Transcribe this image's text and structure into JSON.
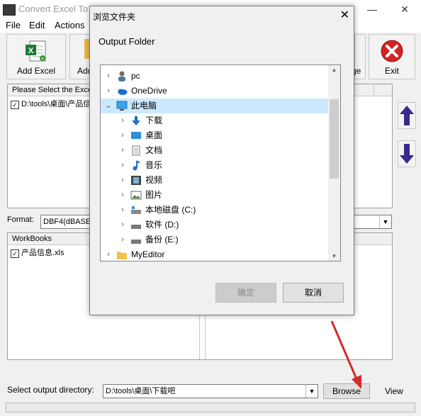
{
  "app": {
    "title": "Convert Excel To DBF"
  },
  "window_controls": {
    "minimize": "—",
    "maximize": "☐",
    "close": "✕"
  },
  "menu": {
    "items": [
      "File",
      "Edit",
      "Actions"
    ]
  },
  "toolbar": {
    "add_excel": "Add Excel",
    "add_partial": "Add",
    "change_partial": "ge",
    "exit": "Exit"
  },
  "file_list": {
    "header": "Please Select the Excel",
    "rows": [
      "D:\\tools\\桌面\\产品信"
    ]
  },
  "format": {
    "label": "Format:",
    "value": "DBF4(dBASE"
  },
  "workbooks": {
    "header": "WorkBooks",
    "rows": [
      "产品信息.xls"
    ]
  },
  "output": {
    "label": "Select  output directory:",
    "value": "D:\\tools\\桌面\\下载吧",
    "browse": "Browse",
    "view": "View"
  },
  "dialog": {
    "title": "浏览文件夹",
    "close": "✕",
    "subtitle": "Output Folder",
    "ok": "确定",
    "cancel": "取消",
    "tree": [
      {
        "label": "pc",
        "icon": "user-icon",
        "chevron": "›"
      },
      {
        "label": "OneDrive",
        "icon": "cloud-icon",
        "chevron": "›"
      },
      {
        "label": "此电脑",
        "icon": "computer-icon",
        "chevron": "⌄"
      },
      {
        "label": "下载",
        "icon": "download-icon",
        "chevron": "›"
      },
      {
        "label": "桌面",
        "icon": "desktop-icon",
        "chevron": "›"
      },
      {
        "label": "文档",
        "icon": "documents-icon",
        "chevron": "›"
      },
      {
        "label": "音乐",
        "icon": "music-icon",
        "chevron": "›"
      },
      {
        "label": "视频",
        "icon": "video-icon",
        "chevron": "›"
      },
      {
        "label": "图片",
        "icon": "pictures-icon",
        "chevron": "›"
      },
      {
        "label": "本地磁盘 (C:)",
        "icon": "drive-icon",
        "chevron": "›"
      },
      {
        "label": "软件 (D:)",
        "icon": "drive-icon",
        "chevron": "›"
      },
      {
        "label": "备份 (E:)",
        "icon": "drive-icon",
        "chevron": "›"
      },
      {
        "label": "MyEditor",
        "icon": "folder-icon",
        "chevron": "›"
      }
    ]
  },
  "colors": {
    "selection": "#cce8ff",
    "accent_blue": "#1e6fc6",
    "arrow_purple": "#3a2a8a",
    "exit_red": "#d32222",
    "annotation_red": "#d42a2a"
  }
}
